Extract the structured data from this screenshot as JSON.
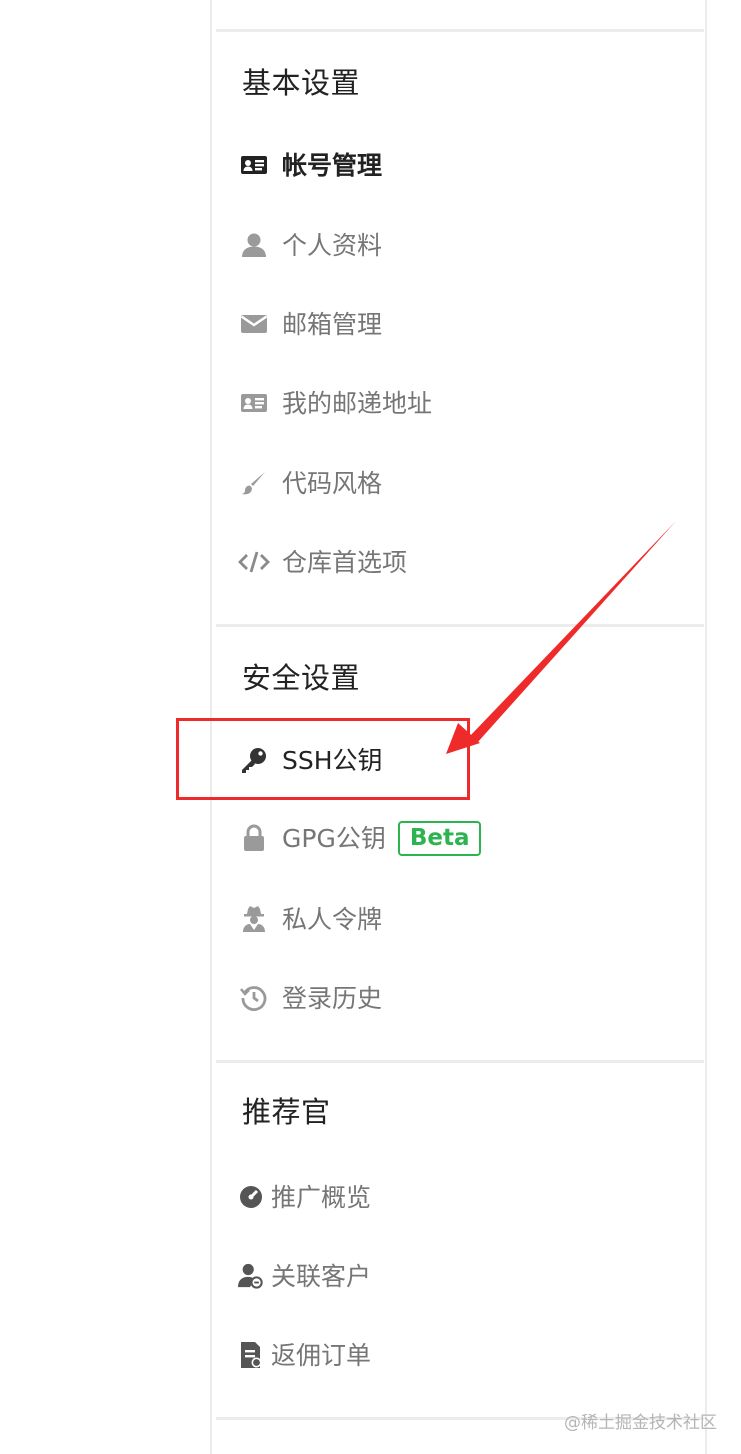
{
  "sections": [
    {
      "title": "基本设置",
      "items": [
        {
          "label": "帐号管理",
          "icon": "id-card-icon"
        },
        {
          "label": "个人资料",
          "icon": "user-icon"
        },
        {
          "label": "邮箱管理",
          "icon": "envelope-icon"
        },
        {
          "label": "我的邮递地址",
          "icon": "address-card-icon"
        },
        {
          "label": "代码风格",
          "icon": "paint-brush-icon"
        },
        {
          "label": "仓库首选项",
          "icon": "code-icon"
        }
      ]
    },
    {
      "title": "安全设置",
      "items": [
        {
          "label": "SSH公钥",
          "icon": "key-icon"
        },
        {
          "label": "GPG公钥",
          "icon": "lock-icon",
          "badge": "Beta"
        },
        {
          "label": "私人令牌",
          "icon": "user-secret-icon"
        },
        {
          "label": "登录历史",
          "icon": "history-icon"
        }
      ]
    },
    {
      "title": "推荐官",
      "items": [
        {
          "label": "推广概览",
          "icon": "dashboard-icon"
        },
        {
          "label": "关联客户",
          "icon": "user-link-icon"
        },
        {
          "label": "返佣订单",
          "icon": "order-icon"
        }
      ]
    }
  ],
  "active_item": "帐号管理",
  "highlighted_item": "SSH公钥",
  "colors": {
    "highlight": "#ef2a2a",
    "badge": "#2db451",
    "active_text": "#222222",
    "inactive_text": "#767676"
  },
  "watermark": "@稀土掘金技术社区"
}
